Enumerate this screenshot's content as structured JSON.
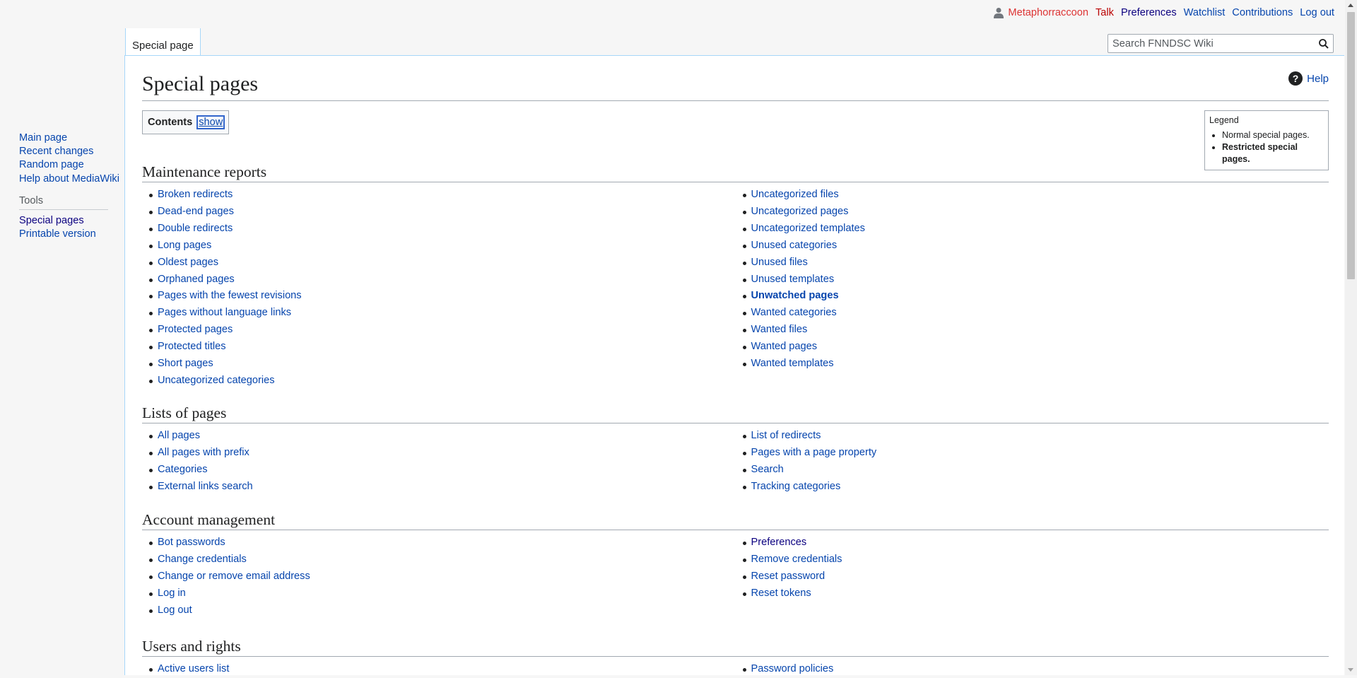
{
  "personal": {
    "username": "Metaphorraccoon",
    "talk": "Talk",
    "preferences": "Preferences",
    "watchlist": "Watchlist",
    "contributions": "Contributions",
    "logout": "Log out"
  },
  "tabs": {
    "special_page": "Special page"
  },
  "search": {
    "placeholder": "Search FNNDSC Wiki"
  },
  "sidebar": {
    "navigation": [
      "Main page",
      "Recent changes",
      "Random page",
      "Help about MediaWiki"
    ],
    "tools_heading": "Tools",
    "tools": [
      "Special pages",
      "Printable version"
    ]
  },
  "page": {
    "title": "Special pages",
    "help": "Help",
    "toc_title": "Contents",
    "toc_toggle": "show"
  },
  "legend": {
    "title": "Legend",
    "normal": "Normal special pages.",
    "restricted": "Restricted special pages."
  },
  "sections": {
    "maintenance": {
      "heading": "Maintenance reports",
      "left": [
        "Broken redirects",
        "Dead-end pages",
        "Double redirects",
        "Long pages",
        "Oldest pages",
        "Orphaned pages",
        "Pages with the fewest revisions",
        "Pages without language links",
        "Protected pages",
        "Protected titles",
        "Short pages",
        "Uncategorized categories"
      ],
      "right": [
        "Uncategorized files",
        "Uncategorized pages",
        "Uncategorized templates",
        "Unused categories",
        "Unused files",
        "Unused templates",
        "Unwatched pages",
        "Wanted categories",
        "Wanted files",
        "Wanted pages",
        "Wanted templates"
      ]
    },
    "lists": {
      "heading": "Lists of pages",
      "left": [
        "All pages",
        "All pages with prefix",
        "Categories",
        "External links search"
      ],
      "right": [
        "List of redirects",
        "Pages with a page property",
        "Search",
        "Tracking categories"
      ]
    },
    "account": {
      "heading": "Account management",
      "left": [
        "Bot passwords",
        "Change credentials",
        "Change or remove email address",
        "Log in",
        "Log out"
      ],
      "right": [
        "Preferences",
        "Remove credentials",
        "Reset password",
        "Reset tokens"
      ]
    },
    "users": {
      "heading": "Users and rights",
      "left": [
        "Active users list"
      ],
      "right": [
        "Password policies"
      ]
    }
  }
}
